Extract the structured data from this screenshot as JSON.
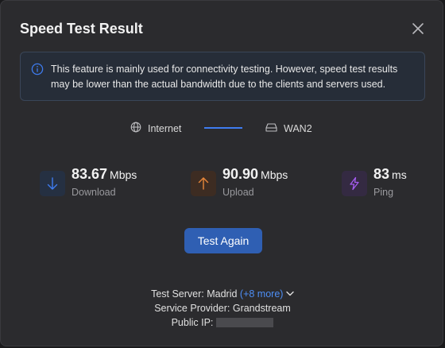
{
  "dialog": {
    "title": "Speed Test Result",
    "close_icon": "close-icon"
  },
  "info": {
    "icon": "info-icon",
    "text": "This feature is mainly used for connectivity testing. However, speed test results may be lower than the actual bandwidth due to the clients and servers used."
  },
  "path": {
    "from_label": "Internet",
    "from_icon": "globe-icon",
    "to_label": "WAN2",
    "to_icon": "router-icon"
  },
  "metrics": {
    "download": {
      "value": "83.67",
      "unit": "Mbps",
      "label": "Download",
      "icon": "arrow-down-icon",
      "color": "#3e7cf0"
    },
    "upload": {
      "value": "90.90",
      "unit": "Mbps",
      "label": "Upload",
      "icon": "arrow-up-icon",
      "color": "#e8873a"
    },
    "ping": {
      "value": "83",
      "unit": "ms",
      "label": "Ping",
      "icon": "lightning-icon",
      "color": "#a55cf0"
    }
  },
  "actions": {
    "test_again_label": "Test Again"
  },
  "footer": {
    "server_label": "Test Server: Madrid",
    "server_more": "(+8 more)",
    "provider": "Service Provider: Grandstream",
    "public_ip_label": "Public IP:"
  }
}
